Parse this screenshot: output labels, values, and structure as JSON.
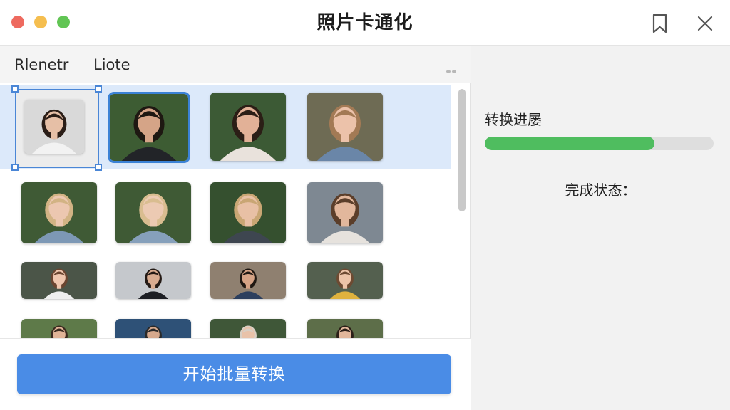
{
  "window": {
    "title": "照片卡通化",
    "icons": {
      "bookmark": "bookmark-icon",
      "close": "close-icon"
    }
  },
  "tabs": [
    {
      "label": "Rlenetr"
    },
    {
      "label": "Liote"
    }
  ],
  "gallery": {
    "selected_index": 0,
    "photos": [
      {
        "name": "woman-dark-hair-white-shirt",
        "bg": "#d9d9d9",
        "hair": "#2a1d17",
        "skin": "#e6bfa6",
        "shirt": "#f2f2f2"
      },
      {
        "name": "man-dark-hair-black-hoodie",
        "bg": "#3d5c33",
        "hair": "#1e1812",
        "skin": "#d5a487",
        "shirt": "#222428"
      },
      {
        "name": "woman-dark-hair-garden",
        "bg": "#3c5a35",
        "hair": "#2b1e16",
        "skin": "#e2b197",
        "shirt": "#e9e2dc"
      },
      {
        "name": "woman-light-brown-hair-denim",
        "bg": "#6e6b54",
        "hair": "#a37a55",
        "skin": "#ecc2aa",
        "shirt": "#6a86a8"
      },
      {
        "name": "woman-blonde-hedge",
        "bg": "#3f5a35",
        "hair": "#d2b384",
        "skin": "#ecc7b0",
        "shirt": "#7d98b5"
      },
      {
        "name": "woman-blonde-hedge-2",
        "bg": "#3f5a35",
        "hair": "#d9bd90",
        "skin": "#eccab3",
        "shirt": "#86a0bb"
      },
      {
        "name": "woman-blonde-dark-top",
        "bg": "#35502f",
        "hair": "#c9a674",
        "skin": "#e8c0a5",
        "shirt": "#3e4650"
      },
      {
        "name": "woman-brown-hair-road",
        "bg": "#7e8892",
        "hair": "#5b3e2a",
        "skin": "#e2b79c",
        "shirt": "#e6e2dd"
      },
      {
        "name": "woman-bangs-white-top",
        "bg": "#4b5548",
        "hair": "#6a4530",
        "skin": "#eec6ae",
        "shirt": "#efefef"
      },
      {
        "name": "woman-dark-hair-grey-bg",
        "bg": "#c5c8cc",
        "hair": "#241a15",
        "skin": "#d9ac90",
        "shirt": "#1d1f24"
      },
      {
        "name": "woman-dark-hair-beach",
        "bg": "#8f8070",
        "hair": "#1f1813",
        "skin": "#d5a386",
        "shirt": "#2c3f5e"
      },
      {
        "name": "woman-bangs-yellow-top",
        "bg": "#54604f",
        "hair": "#6d4a32",
        "skin": "#edc4a9",
        "shirt": "#e0b23e"
      },
      {
        "name": "person-garden-partial",
        "bg": "#5e7a49",
        "hair": "#3a2a1f",
        "skin": "#e0b397",
        "shirt": "#cccccc"
      },
      {
        "name": "person-blue-bg-partial",
        "bg": "#2e5177",
        "hair": "#2a2a2a",
        "skin": "#d6a98d",
        "shirt": "#bbbbbb"
      },
      {
        "name": "person-light-hair-partial",
        "bg": "#3f5738",
        "hair": "#d8cfc4",
        "skin": "#e8c2a9",
        "shirt": "#cccccc"
      },
      {
        "name": "person-flowers-partial",
        "bg": "#5d6e49",
        "hair": "#2b1f18",
        "skin": "#e2b79b",
        "shirt": "#cccccc"
      }
    ]
  },
  "footer": {
    "start_label": "开始批量转换"
  },
  "panel": {
    "progress_label": "转换进屡",
    "progress": 0.74,
    "progress_color": "#4fbd5f",
    "status_label": "完成状态："
  }
}
